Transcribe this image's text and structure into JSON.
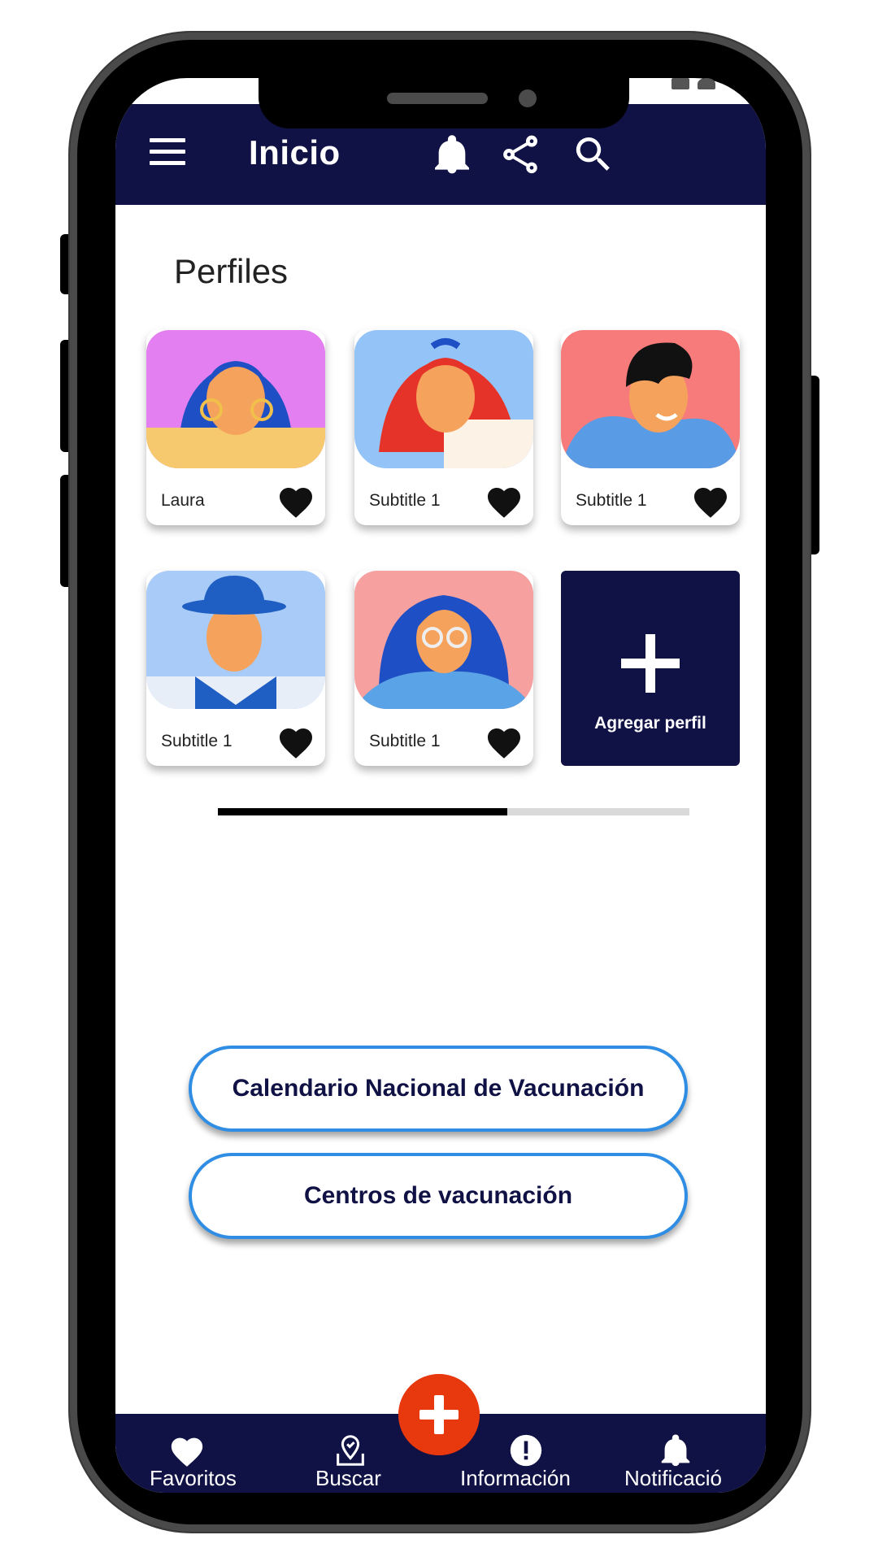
{
  "appbar": {
    "title": "Inicio",
    "icons": [
      "menu-icon",
      "bell-icon",
      "share-icon",
      "search-icon"
    ]
  },
  "profiles": {
    "section_title": "Perfiles",
    "cards": [
      {
        "name": "Laura",
        "bg": "#e37ff0"
      },
      {
        "name": "Subtitle 1",
        "bg": "#93c3f7"
      },
      {
        "name": "Subtitle 1",
        "bg": "#f77b7b"
      },
      {
        "name": "Subtitle 1",
        "bg": "#a9cbf7"
      },
      {
        "name": "Subtitle 1",
        "bg": "#f7a0a0"
      }
    ],
    "add_label": "Agregar perfil"
  },
  "buttons": {
    "calendar": "Calendario Nacional de Vacunación",
    "centers": "Centros de vacunación"
  },
  "bottom_nav": {
    "items": [
      {
        "label": "Favoritos",
        "icon": "heart-icon"
      },
      {
        "label": "Buscar",
        "icon": "map-pin-icon"
      },
      {
        "label": "Información",
        "icon": "info-icon"
      },
      {
        "label": "Notificació",
        "icon": "bell-icon"
      }
    ],
    "fab_icon": "plus-icon"
  },
  "colors": {
    "primary": "#101144",
    "accent": "#2f8de4",
    "fab": "#e8380d"
  }
}
